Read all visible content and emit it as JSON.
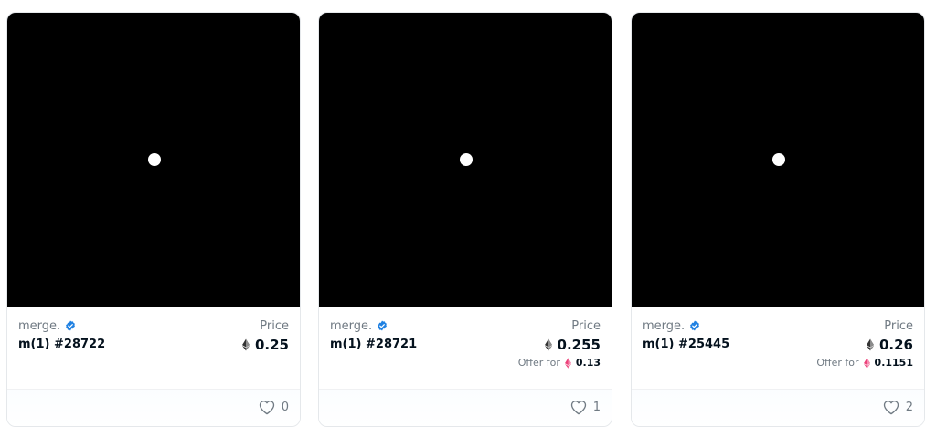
{
  "accent_verified": "#2081e2",
  "offer_icon_color": "#ec4079",
  "cards": [
    {
      "collection": "merge.",
      "token_name": "m(1) #28722",
      "price_label": "Price",
      "price": "0.25",
      "offer_label": "",
      "offer_value": "",
      "likes": "0",
      "icons": {
        "verified": "verified-badge-icon",
        "price": "ethereum-icon",
        "offer": "weth-icon",
        "like": "heart-icon"
      }
    },
    {
      "collection": "merge.",
      "token_name": "m(1) #28721",
      "price_label": "Price",
      "price": "0.255",
      "offer_label": "Offer for",
      "offer_value": "0.13",
      "likes": "1",
      "icons": {
        "verified": "verified-badge-icon",
        "price": "ethereum-icon",
        "offer": "weth-icon",
        "like": "heart-icon"
      }
    },
    {
      "collection": "merge.",
      "token_name": "m(1) #25445",
      "price_label": "Price",
      "price": "0.26",
      "offer_label": "Offer for",
      "offer_value": "0.1151",
      "likes": "2",
      "icons": {
        "verified": "verified-badge-icon",
        "price": "ethereum-icon",
        "offer": "weth-icon",
        "like": "heart-icon"
      }
    }
  ]
}
